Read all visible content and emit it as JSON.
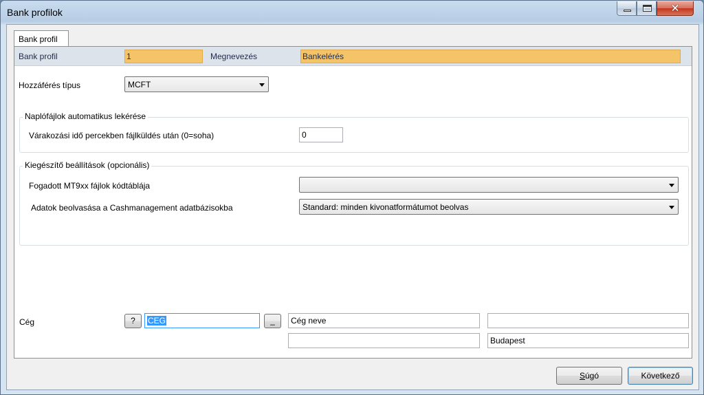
{
  "window": {
    "title": "Bank profilok",
    "controls": {
      "minimize": "minimize",
      "maximize": "maximize",
      "close": "✕"
    }
  },
  "tabs": [
    {
      "label": "Bank profil"
    }
  ],
  "header": {
    "profile_label": "Bank profil",
    "profile_value": "1",
    "name_label": "Megnevezés",
    "name_value": "Bankelérés"
  },
  "access": {
    "label": "Hozzáférés típus",
    "value": "MCFT"
  },
  "log_group": {
    "title": "Naplófájlok automatikus lekérése",
    "wait_label": "Várakozási idő percekben fájlküldés után (0=soha)",
    "wait_value": "0"
  },
  "extra_group": {
    "title": "Kiegészítő beállítások (opcionális)",
    "codepage_label": "Fogadott MT9xx fájlok kódtáblája",
    "codepage_value": "",
    "import_label": "Adatok beolvasása a Cashmanagement adatbázisokba",
    "import_value": "Standard: minden kivonatformátumot beolvas"
  },
  "company": {
    "label": "Cég",
    "help_button": "?",
    "code_value": "CEG",
    "browse_button": "_",
    "name_value": "Cég neve",
    "field3_value": "",
    "field4_value": "",
    "city_value": "Budapest"
  },
  "footer": {
    "help_button_u": "S",
    "help_button_rest": "úgó",
    "next_button": "Következő"
  }
}
